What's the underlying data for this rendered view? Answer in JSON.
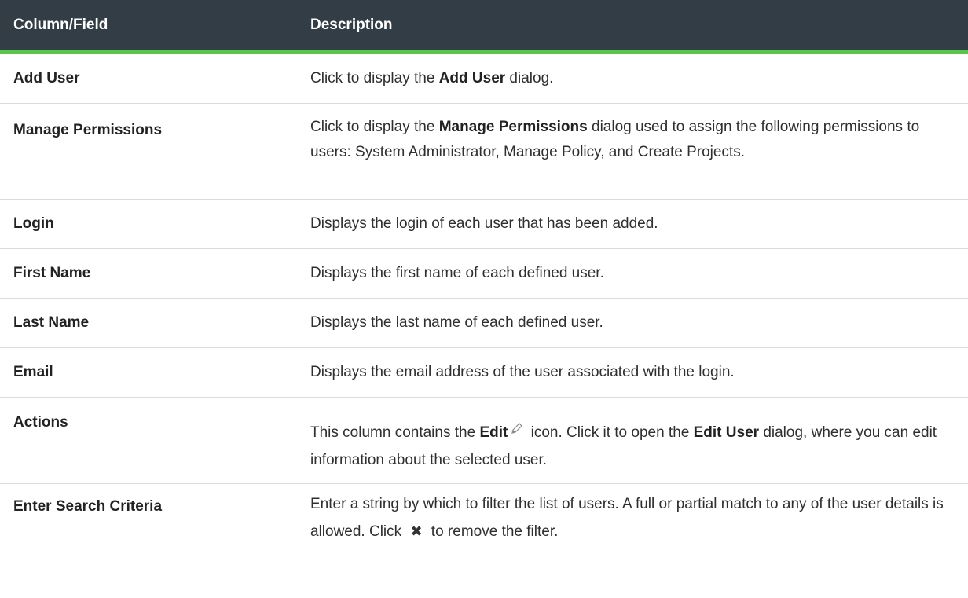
{
  "header": {
    "col1": "Column/Field",
    "col2": "Description"
  },
  "rows": [
    {
      "field": "Add User",
      "parts": [
        "Click to display the ",
        "Add User",
        " dialog."
      ]
    },
    {
      "field": "Manage Permissions",
      "parts": [
        "Click to display the ",
        "Manage Permissions",
        " dialog used to assign the following permissions to users: System Administrator, Manage Policy, and Create Projects."
      ]
    },
    {
      "field": "Login",
      "text": "Displays the login of each user that has been added."
    },
    {
      "field": "First Name",
      "text": "Displays the first name of each defined user."
    },
    {
      "field": "Last Name",
      "text": "Displays the last name of each defined user."
    },
    {
      "field": "Email",
      "text": "Displays the email address of the user associated with the login."
    },
    {
      "field": "Actions",
      "parts": [
        "This column contains the ",
        "Edit",
        " icon. Click it to open the ",
        "Edit User",
        " dialog, where you can edit information about the selected user."
      ],
      "icon": "pencil-icon"
    },
    {
      "field": "Enter Search Criteria",
      "parts": [
        "Enter a string by which to filter the list of users. A full or partial match to any of the user details is allowed. Click ",
        " to remove the filter."
      ],
      "icon": "close-icon",
      "close_glyph": "✖"
    }
  ]
}
